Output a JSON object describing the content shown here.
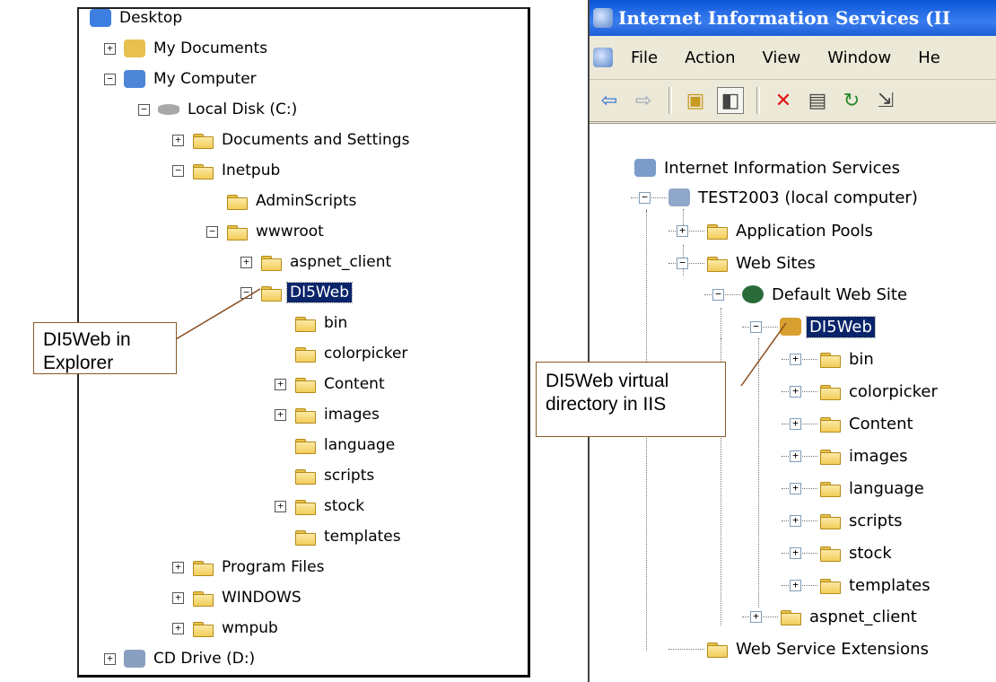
{
  "explorer": {
    "items": [
      {
        "label": "Desktop",
        "icon": "desktop-icon"
      },
      {
        "label": "My Documents",
        "icon": "documents-icon",
        "toggle": "+"
      },
      {
        "label": "My Computer",
        "icon": "computer-icon",
        "toggle": "−"
      },
      {
        "label": "Local Disk (C:)",
        "icon": "disk-icon",
        "toggle": "−"
      },
      {
        "label": "Documents and Settings",
        "icon": "folder-icon",
        "toggle": "+"
      },
      {
        "label": "Inetpub",
        "icon": "folder-icon",
        "toggle": "−"
      },
      {
        "label": "AdminScripts",
        "icon": "folder-icon"
      },
      {
        "label": "wwwroot",
        "icon": "folder-icon",
        "toggle": "−"
      },
      {
        "label": "aspnet_client",
        "icon": "folder-icon",
        "toggle": "+"
      },
      {
        "label": "DI5Web",
        "icon": "folder-open-icon",
        "toggle": "−",
        "selected": true
      },
      {
        "label": "bin",
        "icon": "folder-icon"
      },
      {
        "label": "colorpicker",
        "icon": "folder-icon"
      },
      {
        "label": "Content",
        "icon": "folder-icon",
        "toggle": "+"
      },
      {
        "label": "images",
        "icon": "folder-icon",
        "toggle": "+"
      },
      {
        "label": "language",
        "icon": "folder-icon"
      },
      {
        "label": "scripts",
        "icon": "folder-icon"
      },
      {
        "label": "stock",
        "icon": "folder-icon",
        "toggle": "+"
      },
      {
        "label": "templates",
        "icon": "folder-icon"
      },
      {
        "label": "Program Files",
        "icon": "folder-icon",
        "toggle": "+"
      },
      {
        "label": "WINDOWS",
        "icon": "folder-icon",
        "toggle": "+"
      },
      {
        "label": "wmpub",
        "icon": "folder-icon",
        "toggle": "+"
      },
      {
        "label": "CD Drive (D:)",
        "icon": "cd-drive-icon",
        "toggle": "+"
      }
    ]
  },
  "iis": {
    "title": "Internet Information Services (II",
    "menu": [
      "File",
      "Action",
      "View",
      "Window",
      "He"
    ],
    "toolbar": [
      "back-arrow-icon",
      "forward-arrow-icon",
      "up-folder-icon",
      "show-hide-tree-icon",
      "delete-icon",
      "properties-icon",
      "refresh-icon",
      "export-list-icon"
    ],
    "tree": [
      {
        "label": "Internet Information Services",
        "icon": "iis-icon"
      },
      {
        "label": "TEST2003 (local computer)",
        "icon": "server-icon",
        "toggle": "−"
      },
      {
        "label": "Application Pools",
        "icon": "folder-icon",
        "toggle": "+"
      },
      {
        "label": "Web Sites",
        "icon": "folder-icon",
        "toggle": "−"
      },
      {
        "label": "Default Web Site",
        "icon": "globe-icon",
        "toggle": "−"
      },
      {
        "label": "DI5Web",
        "icon": "virtual-directory-icon",
        "toggle": "−",
        "selected": true
      },
      {
        "label": "bin",
        "icon": "folder-icon",
        "toggle": "+"
      },
      {
        "label": "colorpicker",
        "icon": "folder-icon",
        "toggle": "+"
      },
      {
        "label": "Content",
        "icon": "folder-icon",
        "toggle": "+"
      },
      {
        "label": "images",
        "icon": "folder-icon",
        "toggle": "+"
      },
      {
        "label": "language",
        "icon": "folder-icon",
        "toggle": "+"
      },
      {
        "label": "scripts",
        "icon": "folder-icon",
        "toggle": "+"
      },
      {
        "label": "stock",
        "icon": "folder-icon",
        "toggle": "+"
      },
      {
        "label": "templates",
        "icon": "folder-icon",
        "toggle": "+"
      },
      {
        "label": "aspnet_client",
        "icon": "folder-icon",
        "toggle": "+"
      },
      {
        "label": "Web Service Extensions",
        "icon": "folder-icon"
      }
    ]
  },
  "callouts": {
    "explorer": "DI5Web     in Explorer",
    "iis": "DI5Web  virtual directory in IIS"
  }
}
